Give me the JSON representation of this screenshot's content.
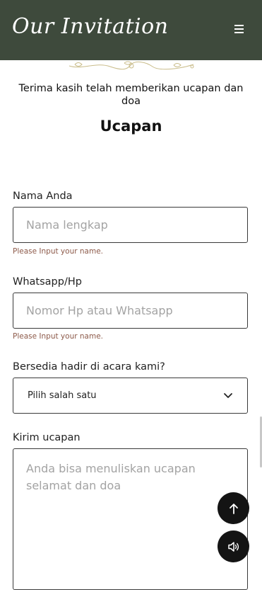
{
  "header": {
    "brand": "Our Invitation"
  },
  "section": {
    "subtitle": "Terima kasih telah memberikan ucapan dan doa",
    "heading": "Ucapan"
  },
  "form": {
    "name": {
      "label": "Nama Anda",
      "placeholder": "Nama lengkap",
      "hint": "Please Input your name."
    },
    "phone": {
      "label": "Whatsapp/Hp",
      "placeholder": "Nomor Hp atau Whatsapp",
      "hint": "Please Input your name."
    },
    "attendance": {
      "label": "Bersedia hadir di acara kami?",
      "selected": "Pilih salah satu"
    },
    "message": {
      "label": "Kirim ucapan",
      "placeholder": "Anda bisa menuliskan ucapan selamat dan doa"
    }
  },
  "icons": {
    "menu": "hamburger-menu-icon",
    "chevron": "chevron-down-icon",
    "scroll_top": "arrow-up-icon",
    "audio": "speaker-volume-icon"
  },
  "colors": {
    "header_bg": "#3e4a3c",
    "hint": "#8d5a4a",
    "button_bg": "#141414",
    "ornament": "#c9bc8a"
  }
}
